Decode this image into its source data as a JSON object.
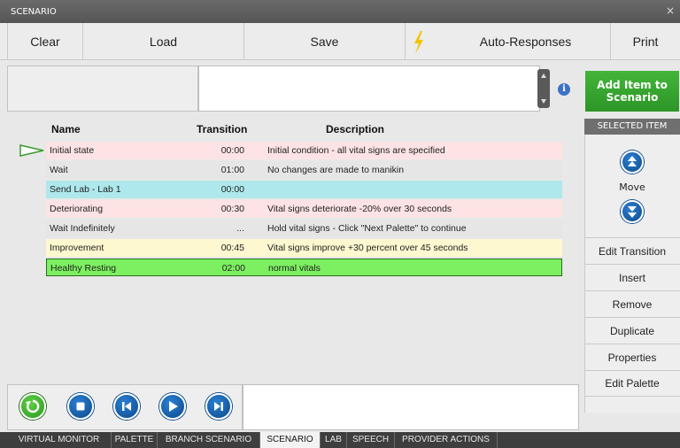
{
  "window": {
    "title": "SCENARIO",
    "close": "×"
  },
  "toolbar": {
    "clear": "Clear",
    "load": "Load",
    "save": "Save",
    "auto_responses": "Auto-Responses",
    "print": "Print"
  },
  "add_button": {
    "line1": "Add Item to",
    "line2": "Scenario"
  },
  "columns": {
    "name": "Name",
    "transition": "Transition",
    "description": "Description"
  },
  "rows": [
    {
      "name": "Initial state",
      "transition": "00:00",
      "description": "Initial condition - all vital signs are specified",
      "bg": "#fde3e3"
    },
    {
      "name": "Wait",
      "transition": "01:00",
      "description": "No changes are made to manikin",
      "bg": "#e6e6e6"
    },
    {
      "name": "Send Lab - Lab 1",
      "transition": "00:00",
      "description": "",
      "bg": "#aee8ec"
    },
    {
      "name": "Deteriorating",
      "transition": "00:30",
      "description": "Vital signs deteriorate -20% over 30 seconds",
      "bg": "#fde3e3"
    },
    {
      "name": "Wait Indefinitely",
      "transition": "...",
      "description": "Hold vital signs - Click \"Next Palette\" to continue",
      "bg": "#e6e6e6"
    },
    {
      "name": "Improvement",
      "transition": "00:45",
      "description": "Vital signs improve +30 percent over 45 seconds",
      "bg": "#fdf8cf"
    },
    {
      "name": "Healthy Resting",
      "transition": "02:00",
      "description": "normal vitals",
      "bg": "#7cf060"
    }
  ],
  "selected_item": {
    "header": "SELECTED ITEM",
    "move": "Move",
    "edit_transition": "Edit Transition",
    "insert": "Insert",
    "remove": "Remove",
    "duplicate": "Duplicate",
    "properties": "Properties",
    "edit_palette": "Edit Palette"
  },
  "tabs": [
    "VIRTUAL MONITOR",
    "PALETTE",
    "BRANCH SCENARIO",
    "SCENARIO",
    "LAB",
    "SPEECH",
    "PROVIDER ACTIONS"
  ],
  "active_tab": "SCENARIO",
  "colors": {
    "accent_green": "#3aa832",
    "accent_blue": "#1565b8",
    "selected_row": "#7cf060"
  }
}
